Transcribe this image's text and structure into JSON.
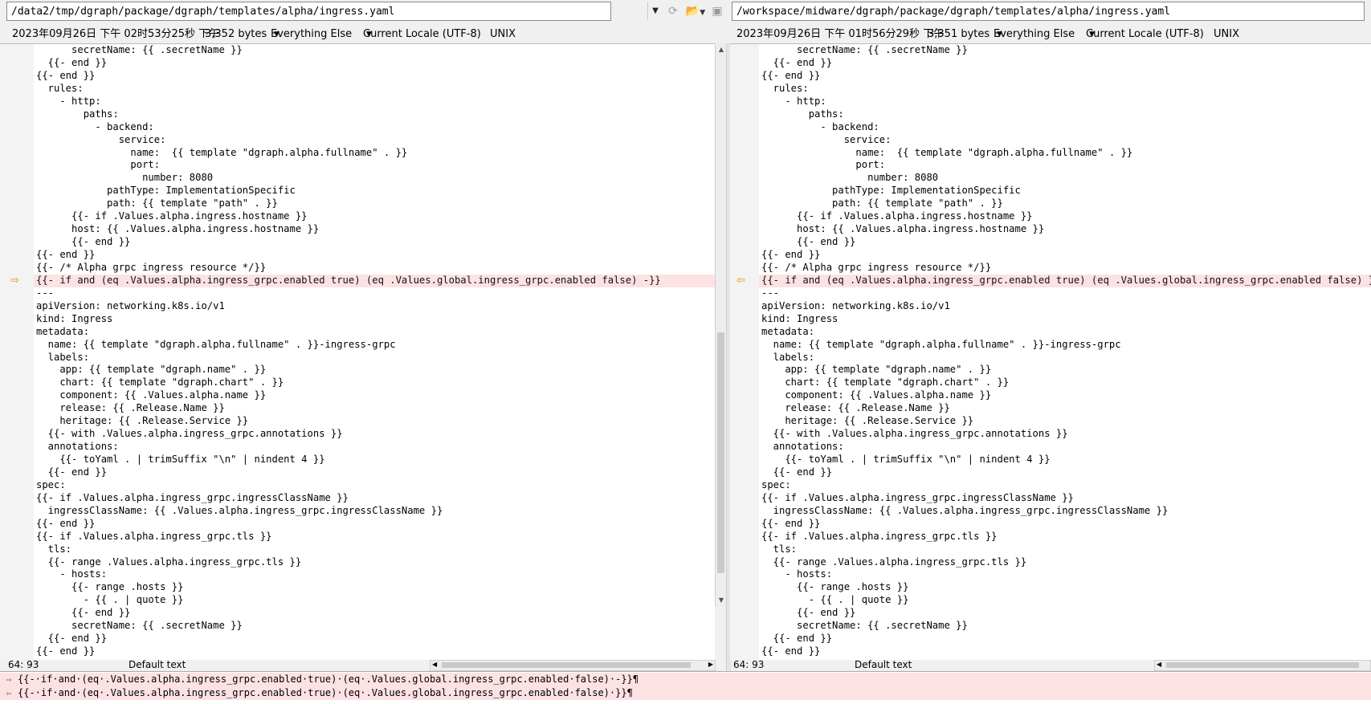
{
  "left": {
    "path": "/data2/tmp/dgraph/package/dgraph/templates/alpha/ingress.yaml",
    "timestamp": "2023年09月26日 下午 02时53分25秒 下午",
    "size": "3,352 bytes",
    "filter": "Everything Else",
    "encoding": "Current Locale (UTF-8)",
    "eol": "UNIX",
    "cursor": "64: 93",
    "style": "Default text"
  },
  "right": {
    "path": "/workspace/midware/dgraph/package/dgraph/templates/alpha/ingress.yaml",
    "timestamp": "2023年09月26日 下午 01时56分29秒 下午",
    "size": "3,351 bytes",
    "filter": "Everything Else",
    "encoding": "Current Locale (UTF-8)",
    "eol": "UNIX",
    "cursor": "64: 93",
    "style": "Default text"
  },
  "left_lines": [
    "      secretName: {{ .secretName }}",
    "  {{- end }}",
    "{{- end }}",
    "  rules:",
    "    - http:",
    "        paths:",
    "          - backend:",
    "              service:",
    "                name:  {{ template \"dgraph.alpha.fullname\" . }}",
    "                port:",
    "                  number: 8080",
    "            pathType: ImplementationSpecific",
    "            path: {{ template \"path\" . }}",
    "      {{- if .Values.alpha.ingress.hostname }}",
    "      host: {{ .Values.alpha.ingress.hostname }}",
    "      {{- end }}",
    "{{- end }}",
    "{{- /* Alpha grpc ingress resource */}}",
    "{{- if and (eq .Values.alpha.ingress_grpc.enabled true) (eq .Values.global.ingress_grpc.enabled false) -}}",
    "---",
    "apiVersion: networking.k8s.io/v1",
    "kind: Ingress",
    "metadata:",
    "  name: {{ template \"dgraph.alpha.fullname\" . }}-ingress-grpc",
    "  labels:",
    "    app: {{ template \"dgraph.name\" . }}",
    "    chart: {{ template \"dgraph.chart\" . }}",
    "    component: {{ .Values.alpha.name }}",
    "    release: {{ .Release.Name }}",
    "    heritage: {{ .Release.Service }}",
    "  {{- with .Values.alpha.ingress_grpc.annotations }}",
    "  annotations:",
    "    {{- toYaml . | trimSuffix \"\\n\" | nindent 4 }}",
    "  {{- end }}",
    "spec:",
    "{{- if .Values.alpha.ingress_grpc.ingressClassName }}",
    "  ingressClassName: {{ .Values.alpha.ingress_grpc.ingressClassName }}",
    "{{- end }}",
    "{{- if .Values.alpha.ingress_grpc.tls }}",
    "  tls:",
    "  {{- range .Values.alpha.ingress_grpc.tls }}",
    "    - hosts:",
    "      {{- range .hosts }}",
    "        - {{ . | quote }}",
    "      {{- end }}",
    "      secretName: {{ .secretName }}",
    "  {{- end }}",
    "{{- end }}"
  ],
  "right_lines": [
    "      secretName: {{ .secretName }}",
    "  {{- end }}",
    "{{- end }}",
    "  rules:",
    "    - http:",
    "        paths:",
    "          - backend:",
    "              service:",
    "                name:  {{ template \"dgraph.alpha.fullname\" . }}",
    "                port:",
    "                  number: 8080",
    "            pathType: ImplementationSpecific",
    "            path: {{ template \"path\" . }}",
    "      {{- if .Values.alpha.ingress.hostname }}",
    "      host: {{ .Values.alpha.ingress.hostname }}",
    "      {{- end }}",
    "{{- end }}",
    "{{- /* Alpha grpc ingress resource */}}",
    "{{- if and (eq .Values.alpha.ingress_grpc.enabled true) (eq .Values.global.ingress_grpc.enabled false) }}",
    "---",
    "apiVersion: networking.k8s.io/v1",
    "kind: Ingress",
    "metadata:",
    "  name: {{ template \"dgraph.alpha.fullname\" . }}-ingress-grpc",
    "  labels:",
    "    app: {{ template \"dgraph.name\" . }}",
    "    chart: {{ template \"dgraph.chart\" . }}",
    "    component: {{ .Values.alpha.name }}",
    "    release: {{ .Release.Name }}",
    "    heritage: {{ .Release.Service }}",
    "  {{- with .Values.alpha.ingress_grpc.annotations }}",
    "  annotations:",
    "    {{- toYaml . | trimSuffix \"\\n\" | nindent 4 }}",
    "  {{- end }}",
    "spec:",
    "{{- if .Values.alpha.ingress_grpc.ingressClassName }}",
    "  ingressClassName: {{ .Values.alpha.ingress_grpc.ingressClassName }}",
    "{{- end }}",
    "{{- if .Values.alpha.ingress_grpc.tls }}",
    "  tls:",
    "  {{- range .Values.alpha.ingress_grpc.tls }}",
    "    - hosts:",
    "      {{- range .hosts }}",
    "        - {{ . | quote }}",
    "      {{- end }}",
    "      secretName: {{ .secretName }}",
    "  {{- end }}",
    "{{- end }}"
  ],
  "diff_line_index": 18,
  "bottom": {
    "line1": "{{-·if·and·(eq·.Values.alpha.ingress_grpc.enabled·true)·(eq·.Values.global.ingress_grpc.enabled·false)·-}}¶",
    "line2": "{{-·if·and·(eq·.Values.alpha.ingress_grpc.enabled·true)·(eq·.Values.global.ingress_grpc.enabled·false)·}}¶"
  },
  "icons": {
    "dropdown": "chevron-down-icon",
    "reload": "reload-icon",
    "open": "folder-open-icon",
    "save": "save-icon",
    "diff_arrow_left": "arrow-right-icon",
    "diff_arrow_right": "arrow-left-icon"
  },
  "colors": {
    "diff_bg": "#fde2e4",
    "arrow": "#d49a00"
  }
}
